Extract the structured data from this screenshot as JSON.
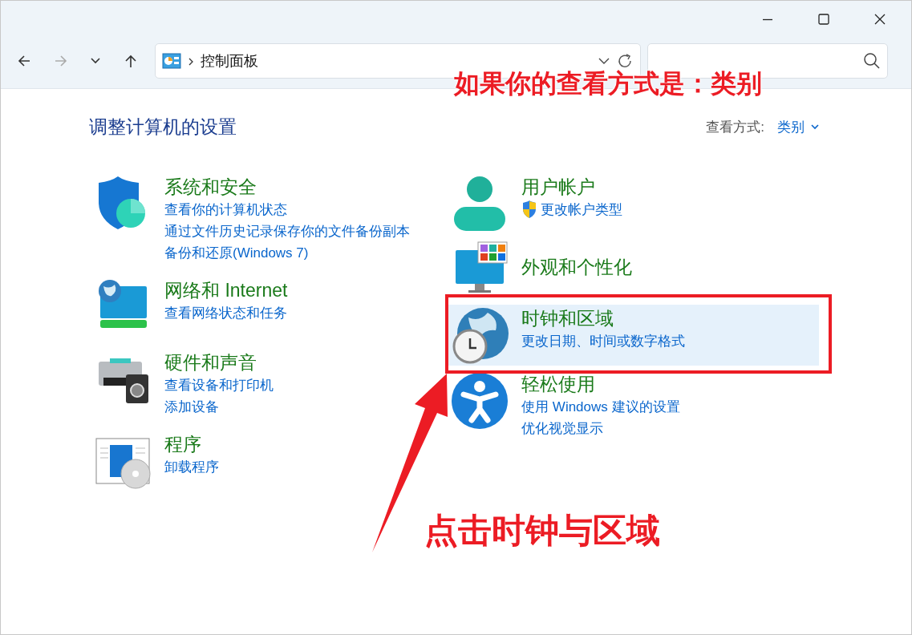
{
  "nav": {
    "back": {
      "disabled": false
    },
    "forward": {
      "disabled": true
    },
    "up": {
      "disabled": false
    }
  },
  "address_bar": {
    "path": "控制面板"
  },
  "heading": "调整计算机的设置",
  "view_by": {
    "label": "查看方式:",
    "value": "类别"
  },
  "columns": [
    {
      "categories": [
        {
          "title": "系统和安全",
          "highlighted": false,
          "links": [
            {
              "text": "查看你的计算机状态",
              "elevated": false
            },
            {
              "text": "通过文件历史记录保存你的文件备份副本",
              "elevated": false
            },
            {
              "text": "备份和还原(Windows 7)",
              "elevated": false
            }
          ]
        },
        {
          "title": "网络和 Internet",
          "highlighted": false,
          "links": [
            {
              "text": "查看网络状态和任务",
              "elevated": false
            }
          ]
        },
        {
          "title": "硬件和声音",
          "highlighted": false,
          "links": [
            {
              "text": "查看设备和打印机",
              "elevated": false
            },
            {
              "text": "添加设备",
              "elevated": false
            }
          ]
        },
        {
          "title": "程序",
          "highlighted": false,
          "links": [
            {
              "text": "卸载程序",
              "elevated": false
            }
          ]
        }
      ]
    },
    {
      "categories": [
        {
          "title": "用户帐户",
          "highlighted": false,
          "links": [
            {
              "text": "更改帐户类型",
              "elevated": true
            }
          ]
        },
        {
          "title": "外观和个性化",
          "highlighted": false
        },
        {
          "title": "时钟和区域",
          "highlighted": true,
          "links": [
            {
              "text": "更改日期、时间或数字格式",
              "elevated": false
            }
          ]
        },
        {
          "title": "轻松使用",
          "highlighted": false,
          "links": [
            {
              "text": "使用 Windows 建议的设置",
              "elevated": false
            },
            {
              "text": "优化视觉显示",
              "elevated": false
            }
          ]
        }
      ]
    }
  ],
  "annotations": [
    {
      "kind": "text",
      "text": "如果你的查看方式是：类别"
    },
    {
      "kind": "box"
    },
    {
      "kind": "arrow"
    },
    {
      "kind": "text",
      "text": "点击时钟与区域"
    }
  ]
}
